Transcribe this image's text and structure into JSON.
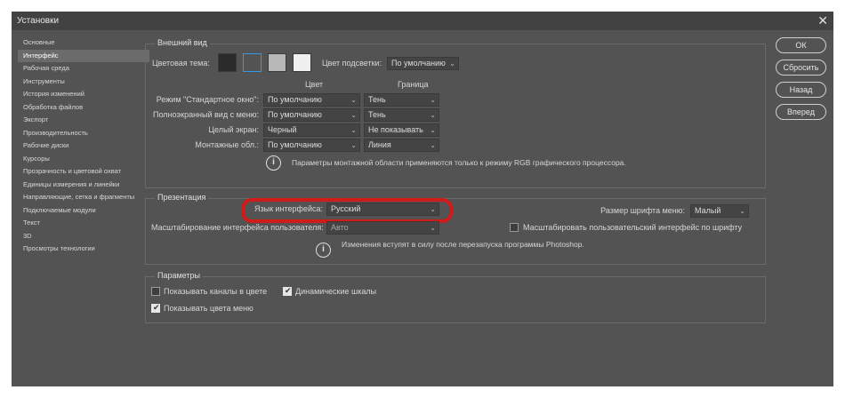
{
  "window": {
    "title": "Установки",
    "close_glyph": "✕"
  },
  "sidebar": {
    "items": [
      "Основные",
      "Интерфейс",
      "Рабочая среда",
      "Инструменты",
      "История изменений",
      "Обработка файлов",
      "Экспорт",
      "Производительность",
      "Рабочие диски",
      "Курсоры",
      "Прозрачность и цветовой охват",
      "Единицы измерения и линейки",
      "Направляющие, сетка и фрагменты",
      "Подключаемые модули",
      "Текст",
      "3D",
      "Просмотры технологии"
    ],
    "selected_index": 1
  },
  "appearance": {
    "title": "Внешний вид",
    "color_theme_label": "Цветовая тема:",
    "themes": [
      "#2b2b2b",
      "#535353",
      "#b8b8b8",
      "#f0f0f0"
    ],
    "selected_theme_index": 1,
    "highlight_label": "Цвет подсветки:",
    "highlight_value": "По умолчанию",
    "col_color": "Цвет",
    "col_border": "Граница",
    "rows": [
      {
        "label": "Режим \"Стандартное окно\":",
        "color": "По умолчанию",
        "border": "Тень"
      },
      {
        "label": "Полноэкранный вид с меню:",
        "color": "По умолчанию",
        "border": "Тень"
      },
      {
        "label": "Целый экран:",
        "color": "Черный",
        "border": "Не показывать"
      },
      {
        "label": "Монтажные обл.:",
        "color": "По умолчанию",
        "border": "Линия"
      }
    ],
    "info": "Параметры монтажной области применяются только к режиму RGB графического процессора."
  },
  "presentation": {
    "title": "Презентация",
    "language_label": "Язык интерфейса:",
    "language_value": "Русский",
    "font_size_label": "Размер шрифта меню:",
    "font_size_value": "Малый",
    "scaling_label": "Масштабирование интерфейса пользователя:",
    "scaling_value": "Авто",
    "scale_by_font_label": "Масштабировать пользовательский интерфейс по шрифту",
    "scale_by_font_checked": false,
    "info": "Изменения вступят в силу после перезапуска программы Photoshop."
  },
  "params": {
    "title": "Параметры",
    "show_channels_label": "Показывать каналы в цвете",
    "show_channels_checked": false,
    "dynamic_sliders_label": "Динамические шкалы",
    "dynamic_sliders_checked": true,
    "show_menu_colors_label": "Показывать цвета меню",
    "show_menu_colors_checked": true
  },
  "buttons": {
    "ok": "ОК",
    "reset": "Сбросить",
    "back": "Назад",
    "forward": "Вперед"
  },
  "icons": {
    "info": "i",
    "chevron": "⌄"
  }
}
